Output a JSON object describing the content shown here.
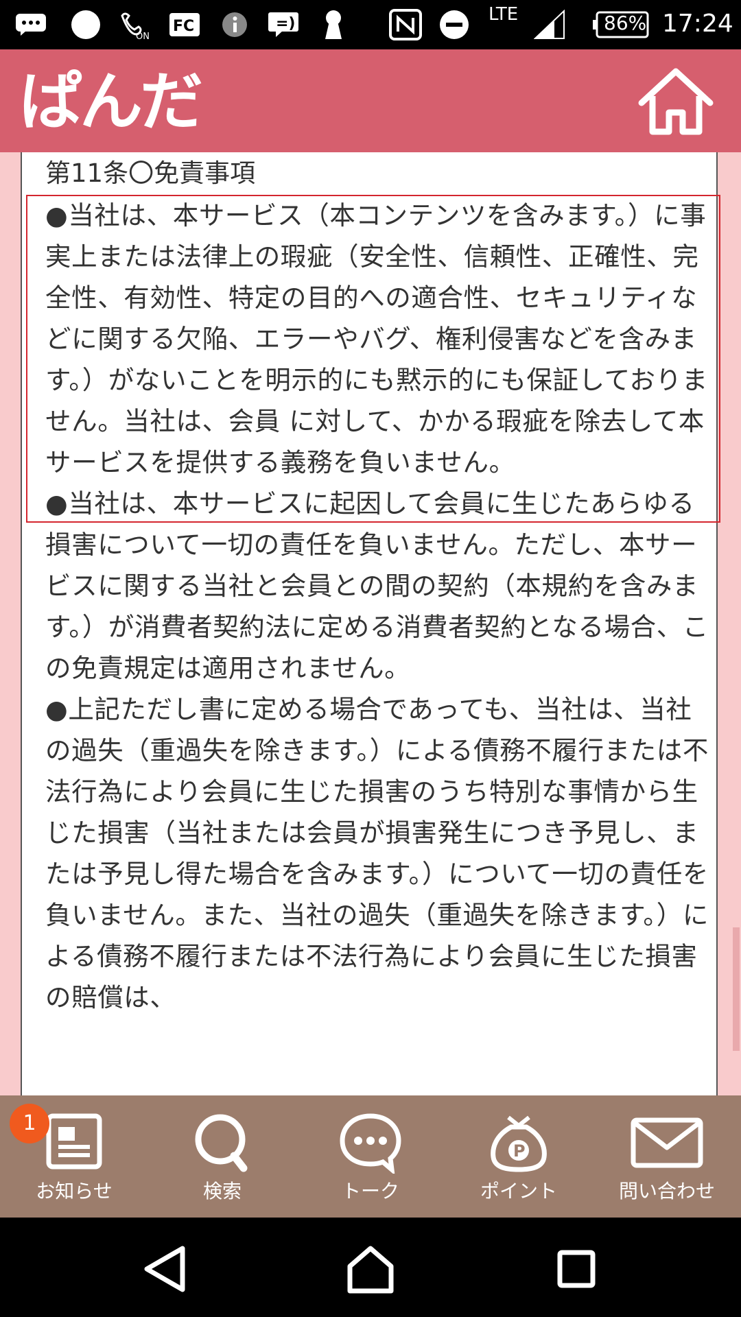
{
  "status_bar": {
    "lte": "LTE",
    "battery": "86%",
    "time": "17:24",
    "icons": [
      "chat-bubble-icon",
      "circle-icon",
      "wifi-calling-icon",
      "fc-icon",
      "info-icon",
      "voice-message-icon",
      "keyhole-icon",
      "nfc-icon",
      "dnd-icon",
      "signal-icon",
      "battery-icon"
    ]
  },
  "header": {
    "logo_text": "ぱんだ",
    "home_icon": "home-icon"
  },
  "article": {
    "title": "第11条〇免責事項",
    "paragraphs": [
      "●当社は、本サービス（本コンテンツを含みます。）に事実上または法律上の瑕疵（安全性、信頼性、正確性、完全性、有効性、特定の目的への適合性、セキュリティなどに関する欠陥、エラーやバグ、権利侵害などを含みます。）がないことを明示的にも黙示的にも保証しておりません。当社は、会員 に対して、かかる瑕疵を除去して本サービスを提供する義務を負いません。",
      "●当社は、本サービスに起因して会員に生じたあらゆる損害について一切の責任を負いません。ただし、本サービスに関する当社と会員との間の契約（本規約を含みます。）が消費者契約法に定める消費者契約となる場合、この免責規定は適用されません。",
      "●上記ただし書に定める場合であっても、当社は、当社の過失（重過失を除きます。）による債務不履行または不法行為により会員に生じた損害のうち特別な事情から生じた損害（当社または会員が損害発生につき予見し、または予見し得た場合を含みます。）について一切の責任を負いません。また、当社の過失（重過失を除きます。）による債務不履行または不法行為により会員に生じた損害の賠償は、"
    ]
  },
  "bottom_nav": {
    "items": [
      {
        "label": "お知らせ",
        "icon": "news-icon",
        "badge": "1"
      },
      {
        "label": "検索",
        "icon": "search-icon"
      },
      {
        "label": "トーク",
        "icon": "chat-icon"
      },
      {
        "label": "ポイント",
        "icon": "point-bag-icon"
      },
      {
        "label": "問い合わせ",
        "icon": "mail-icon"
      }
    ]
  },
  "system_nav": {
    "buttons": [
      "back-icon",
      "home-icon",
      "recents-icon"
    ]
  },
  "colors": {
    "header": "#d65f6e",
    "nav": "#9c7d6c",
    "highlight_border": "#d4262e",
    "badge": "#f05a1e",
    "side_bg": "#f9cbcc"
  }
}
